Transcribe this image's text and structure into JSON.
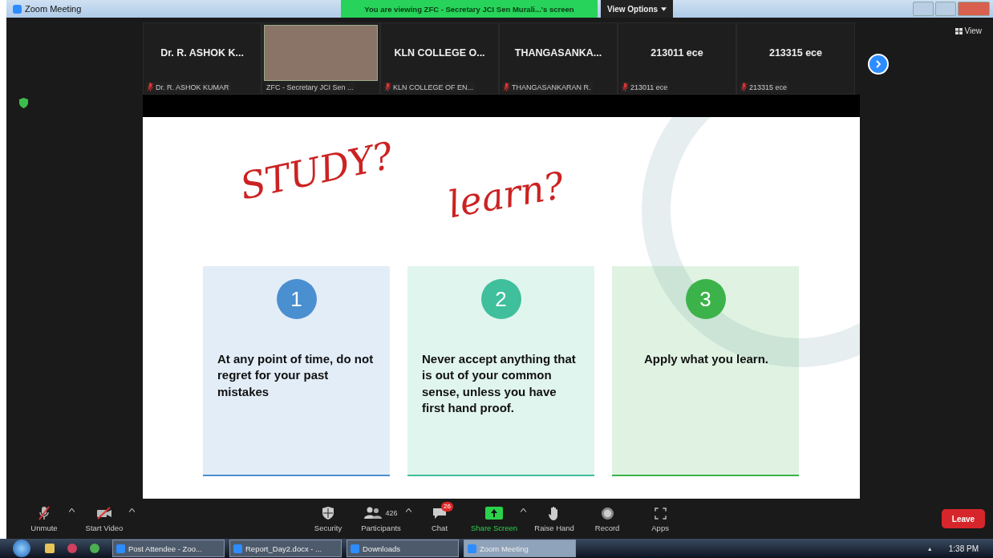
{
  "window": {
    "title": "Zoom Meeting"
  },
  "banner": {
    "text": "You are viewing ZFC - Secretary JCI Sen Murali...'s screen",
    "view_options": "View Options"
  },
  "view_button": "View",
  "participants": [
    {
      "kind": "name",
      "display": "Dr. R. ASHOK K...",
      "label": "Dr. R. ASHOK KUMAR",
      "muted": true
    },
    {
      "kind": "video",
      "label": "ZFC - Secretary JCI Sen ...",
      "muted": false
    },
    {
      "kind": "name",
      "display": "KLN COLLEGE O...",
      "label": "KLN COLLEGE OF EN...",
      "muted": true
    },
    {
      "kind": "name",
      "display": "THANGASANKA...",
      "label": "THANGASANKARAN R.",
      "muted": true
    },
    {
      "kind": "name",
      "display": "213011 ece",
      "label": "213011 ece",
      "muted": true
    },
    {
      "kind": "name",
      "display": "213315 ece",
      "label": "213315 ece",
      "muted": true
    }
  ],
  "slide": {
    "annotations": [
      "STUDY?",
      "learn?"
    ],
    "cards": [
      {
        "number": "1",
        "text": "At any point of time, do not regret for your past mistakes",
        "color": "#4a8fd0"
      },
      {
        "number": "2",
        "text": "Never accept anything that is out of your common sense, unless you have first hand proof.",
        "color": "#3fbf9b"
      },
      {
        "number": "3",
        "text": "Apply what you learn.",
        "color": "#3cb34a"
      }
    ]
  },
  "toolbar": [
    {
      "kind": "mic",
      "label": "Unmute",
      "caret": true
    },
    {
      "kind": "video",
      "label": "Start Video",
      "caret": true
    },
    {
      "kind": "security",
      "label": "Security",
      "caret": false
    },
    {
      "kind": "participants",
      "label": "Participants",
      "count": "426",
      "caret": true
    },
    {
      "kind": "chat",
      "label": "Chat",
      "badge": "26",
      "caret": false
    },
    {
      "kind": "share",
      "label": "Share Screen",
      "caret": true
    },
    {
      "kind": "hand",
      "label": "Raise Hand",
      "caret": false
    },
    {
      "kind": "record",
      "label": "Record",
      "caret": false
    },
    {
      "kind": "apps",
      "label": "Apps",
      "caret": false
    }
  ],
  "leave": "Leave",
  "taskbar": {
    "windows": [
      {
        "label": "Post Attendee - Zoo...",
        "selected": false
      },
      {
        "label": "Report_Day2.docx - ...",
        "selected": false
      },
      {
        "label": "Downloads",
        "selected": false
      },
      {
        "label": "Zoom Meeting",
        "selected": true
      }
    ],
    "tray_caret": "▲",
    "clock": "1:38 PM"
  }
}
